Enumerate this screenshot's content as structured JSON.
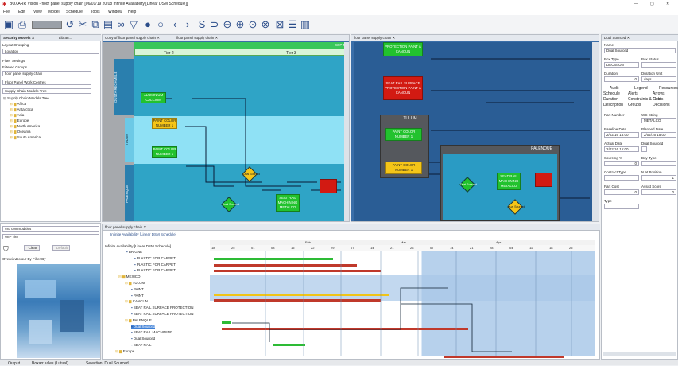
{
  "window": {
    "title": "BOXARR Vision - floor panel supply chain [06/01/19 20:08 Infinite Availability [Linear DSM Schedule]]",
    "min": "—",
    "max": "▢",
    "close": "✕"
  },
  "menu": [
    "File",
    "Edit",
    "View",
    "Model",
    "Schedule",
    "Tools",
    "Window",
    "Help"
  ],
  "toolbar": {
    "icons": [
      "save-icon",
      "print-icon",
      "search-box",
      "undo-icon",
      "cut-icon",
      "copy-icon",
      "paste-icon",
      "link-icon",
      "filter-icon",
      "play-icon",
      "stop-icon",
      "prev-icon",
      "next-icon",
      "loop-icon",
      "zoom-fit-icon",
      "zoom-in-icon",
      "zoom-out-icon",
      "zoom-reset-icon",
      "grid-icon",
      "layout-icon",
      "gantt-icon"
    ]
  },
  "left": {
    "tabs": [
      "Security Models",
      "Libran..."
    ],
    "layout_grouping": "Layout Grouping",
    "location": "Location",
    "filter_tabs": [
      "Filter",
      "Settings"
    ],
    "filtered_groups": "Filtered Groups",
    "select1": "floor panel supply chain",
    "select2": "Floor Panel Work Centres",
    "select3": "Supply Chain Models Tree",
    "tree": [
      "Supply Chain Models Tree",
      "Africa",
      "Antarctica",
      "Asia",
      "Europe",
      "North America",
      "Oceania",
      "South America"
    ],
    "lower_select1": "ssc commodities",
    "lower_select2": "WIP Tier",
    "clear": "Clear",
    "default": "Default",
    "overview_tabs": [
      "Overview",
      "Colour By",
      "Filter By"
    ]
  },
  "center": {
    "tabs": [
      "Copy of floor panel supply chain",
      "floor panel supply chain"
    ],
    "wip": "WIP Ti",
    "tier2": "Tier 2",
    "tier3": "Tier 3",
    "lanes": [
      "OUSTA RECHMELE",
      "TULUM",
      "PALENQUE"
    ],
    "nodes": [
      {
        "t": "ALUMINIUM CALCIUM",
        "c": "grn"
      },
      {
        "t": "PAINT COLOR NUMBER 1",
        "c": "yel"
      },
      {
        "t": "PAINT COLOR NUMBER 1",
        "c": "grn"
      },
      {
        "t": "Dual Sourced",
        "c": "yel"
      },
      {
        "t": "Dual Sourced",
        "c": "grn"
      },
      {
        "t": "SEAT RAIL MACHINING METALCO",
        "c": "grn"
      },
      {
        "t": "",
        "c": "red"
      }
    ]
  },
  "right_canvas": {
    "tab": "floor panel supply chain",
    "nodes": [
      {
        "t": "PROTECTION PAINT & CANCUN",
        "c": "grn"
      },
      {
        "t": "SEAT RAIL SURFACE PROTECTION PAINT & CANCUN",
        "c": "red"
      },
      {
        "t": "PAINT COLOR NUMBER 1",
        "c": "grn"
      },
      {
        "t": "PAINT COLOR NUMBER 1",
        "c": "yel"
      },
      {
        "t": "Dual Sourced",
        "c": "grn"
      },
      {
        "t": "SEAT RAIL MACHINING METALCO",
        "c": "grn"
      },
      {
        "t": "",
        "c": "red"
      },
      {
        "t": "Dual Sourced",
        "c": "yel"
      }
    ],
    "groups": [
      "TULUM",
      "PALENQUE"
    ]
  },
  "props": {
    "tab": "Dual Sourced",
    "name_label": "Name",
    "name": "Dual Sourced",
    "box_type_label": "Box Type",
    "box_status_label": "Box Status",
    "box_type": "DECISION",
    "box_status": "T",
    "duration_label": "Duration",
    "duration_unit_label": "Duration Unit",
    "duration": "0",
    "duration_unit": "days",
    "tabs": [
      "Audit",
      "Legend",
      "Resources",
      "Schedule",
      "Alerts",
      "Arrows",
      "Duration",
      "Constraints & Cost",
      "Fields",
      "Description",
      "Groups",
      "Decisions"
    ],
    "part_number_label": "Part Number",
    "wc_string_label": "WC String",
    "wc_string": "METALCO",
    "baseline_date_label": "Baseline Date",
    "planned_date_label": "Planned Date",
    "baseline_date": "2/02/16 15:00",
    "planned_date": "2/02/16 15:00",
    "actual_date_label": "Actual Date",
    "dual_sourced_label": "Dual Sourced",
    "actual_date": "2/02/16 15:00",
    "sourcing_label": "Sourcing %",
    "buy_type_label": "Buy Type",
    "sourcing": "0",
    "contract_type_label": "Contract Type",
    "n_at_position_label": "N at Position",
    "n_at_position": "1",
    "part_cost_label": "Part Cost",
    "assist_score_label": "Assist Score",
    "part_cost": "0",
    "assist_score": "0",
    "type_label": "Type"
  },
  "gantt": {
    "tab": "floor panel supply chain",
    "subtitle": "Infinite Availability [Linear DSM Schedule]",
    "root": "Infinite Availability [Linear DSM Schedule]",
    "rows": [
      "BRIGNE",
      "PLASTIC FOR CARPET",
      "PLASTIC FOR CARPET",
      "PLASTIC FOR CARPET",
      "MEXICO",
      "TULUM",
      "PAINT",
      "PAINT",
      "CANCUN",
      "SEAT RAIL SURFACE PROTECTION",
      "SEAT RAIL SURFACE PROTECTION",
      "PALENQUE",
      "Dual Sourced",
      "SEAT RAIL MACHINING",
      "Dual Sourced",
      "SEAT RAIL",
      "Europe"
    ],
    "months": [
      "Feb",
      "Mar",
      "Apr"
    ],
    "days": [
      "18",
      "25",
      "01",
      "08",
      "15",
      "22",
      "29",
      "07",
      "14",
      "21",
      "28",
      "07",
      "14",
      "21",
      "28",
      "04",
      "11",
      "18",
      "25"
    ]
  },
  "status": {
    "output": "Output",
    "output2": "Boxarr.sales.(Lutual)",
    "selection": "Selection: Dual Sourced"
  },
  "colors": {
    "lane_cyan": "#8fe1f5",
    "lane_teal": "#2fa4c6",
    "node_green": "#22c22e",
    "node_yellow": "#f5c518",
    "node_red": "#d21a12",
    "dark_bg": "#2f6fae",
    "gantt_blue": "#b9d3ec"
  }
}
